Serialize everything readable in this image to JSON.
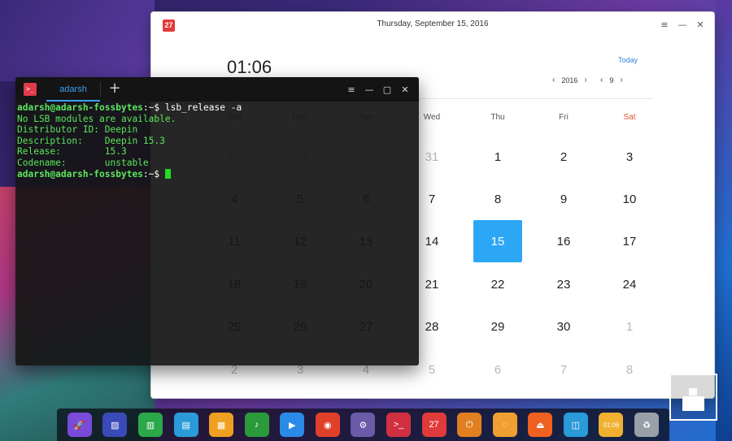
{
  "calendar": {
    "app_icon_label": "27",
    "title": "Thursday, September 15, 2016",
    "time": "01:06",
    "today_label": "Today",
    "year": "2016",
    "month": "9",
    "weekdays": [
      "Sun",
      "Mon",
      "Tue",
      "Wed",
      "Thu",
      "Fri",
      "Sat"
    ],
    "weeks": [
      [
        "28",
        "29",
        "30",
        "31",
        "1",
        "2",
        "3"
      ],
      [
        "4",
        "5",
        "6",
        "7",
        "8",
        "9",
        "10"
      ],
      [
        "11",
        "12",
        "13",
        "14",
        "15",
        "16",
        "17"
      ],
      [
        "18",
        "19",
        "20",
        "21",
        "22",
        "23",
        "24"
      ],
      [
        "25",
        "26",
        "27",
        "28",
        "29",
        "30",
        "1"
      ],
      [
        "2",
        "3",
        "4",
        "5",
        "6",
        "7",
        "8"
      ]
    ],
    "selected_day": "15",
    "colors": {
      "selected": "#2ca7f5",
      "saturday": "#e0533a",
      "today_link": "#2c87d8"
    }
  },
  "window_controls": {
    "menu": "≡",
    "minimize": "—",
    "maximize": "▢",
    "close": "✕"
  },
  "terminal": {
    "tab_label": "adarsh",
    "add_tab": "+",
    "lines": [
      {
        "kind": "prompt",
        "user": "adarsh@adarsh-fossbytes",
        "path": ":~",
        "dollar": "$ ",
        "cmd": "lsb_release -a"
      },
      {
        "kind": "out",
        "text": "No LSB modules are available."
      },
      {
        "kind": "out",
        "text": "Distributor ID: Deepin"
      },
      {
        "kind": "out",
        "text": "Description:    Deepin 15.3"
      },
      {
        "kind": "out",
        "text": "Release:        15.3"
      },
      {
        "kind": "out",
        "text": "Codename:       unstable"
      },
      {
        "kind": "prompt",
        "user": "adarsh@adarsh-fossbytes",
        "path": ":~",
        "dollar": "$ ",
        "cmd": ""
      }
    ]
  },
  "dock": {
    "items": [
      {
        "name": "launcher-icon",
        "color": "#7a4ad8",
        "glyph": "🚀"
      },
      {
        "name": "multitasking-icon",
        "color": "#3a4ab8",
        "glyph": "▨"
      },
      {
        "name": "file-manager-icon",
        "color": "#2aa84a",
        "glyph": "▥"
      },
      {
        "name": "archive-icon",
        "color": "#2a9ad8",
        "glyph": "▤"
      },
      {
        "name": "store-icon",
        "color": "#f0a020",
        "glyph": "▦"
      },
      {
        "name": "music-icon",
        "color": "#2a9a3a",
        "glyph": "♪"
      },
      {
        "name": "video-icon",
        "color": "#2a8ae8",
        "glyph": "▶"
      },
      {
        "name": "chrome-icon",
        "color": "#e0402a",
        "glyph": "◉"
      },
      {
        "name": "settings-icon",
        "color": "#6a5aa8",
        "glyph": "⚙"
      },
      {
        "name": "terminal-icon",
        "color": "#d03040",
        "glyph": ">_"
      },
      {
        "name": "calendar-icon",
        "color": "#e03a3a",
        "glyph": "27"
      },
      {
        "name": "power-icon",
        "color": "#e08020",
        "glyph": "⏻"
      },
      {
        "name": "update-icon",
        "color": "#f0a030",
        "glyph": "◌"
      },
      {
        "name": "eject-icon",
        "color": "#f06020",
        "glyph": "⏏"
      },
      {
        "name": "monitor-icon",
        "color": "#2a9ad8",
        "glyph": "◫"
      },
      {
        "name": "clock-icon",
        "color": "#f0b030",
        "glyph": "01:06"
      },
      {
        "name": "trash-icon",
        "color": "#9aa0a8",
        "glyph": "♻"
      }
    ]
  }
}
